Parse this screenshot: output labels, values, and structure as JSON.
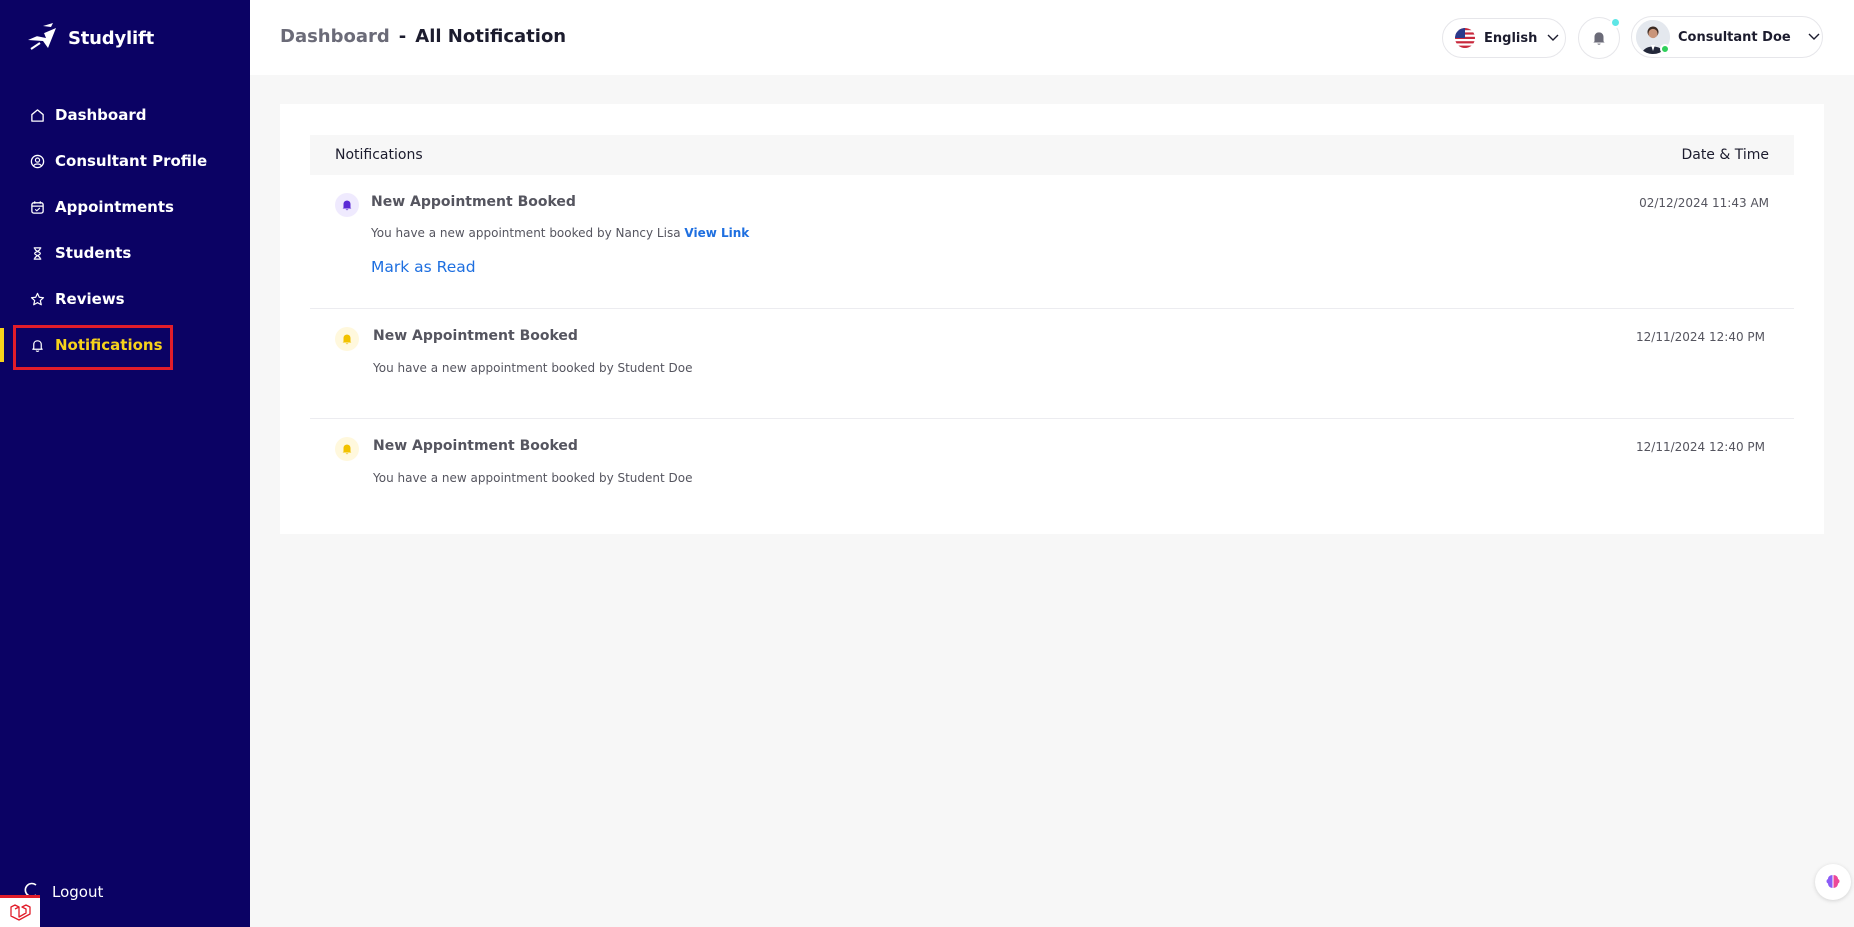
{
  "app": {
    "brand": "Studylift"
  },
  "sidebar": {
    "items": [
      {
        "label": "Dashboard",
        "icon": "home-icon"
      },
      {
        "label": "Consultant Profile",
        "icon": "user-circle-icon"
      },
      {
        "label": "Appointments",
        "icon": "calendar-icon"
      },
      {
        "label": "Students",
        "icon": "hourglass-icon"
      },
      {
        "label": "Reviews",
        "icon": "star-icon"
      },
      {
        "label": "Notifications",
        "icon": "bell-icon",
        "active": true
      }
    ],
    "logout_label": "Logout"
  },
  "header": {
    "crumb_home": "Dashboard",
    "crumb_sep": "-",
    "crumb_current": "All Notification",
    "language": "English",
    "user_name": "Consultant Doe"
  },
  "table": {
    "col_notifications": "Notifications",
    "col_datetime": "Date & Time"
  },
  "notifications": [
    {
      "title": "New Appointment Booked",
      "body": "You have a new appointment booked by Nancy Lisa",
      "link": "View Link",
      "time": "02/12/2024 11:43 AM",
      "action": "Mark as Read",
      "unread": true
    },
    {
      "title": "New Appointment Booked",
      "body": "You have a new appointment booked by Student Doe",
      "time": "12/11/2024 12:40 PM",
      "unread": false
    },
    {
      "title": "New Appointment Booked",
      "body": "You have a new appointment booked by Student Doe",
      "time": "12/11/2024 12:40 PM",
      "unread": false
    }
  ],
  "colors": {
    "sidebar_bg": "#0b0264",
    "accent_yellow": "#f7d21b",
    "link_blue": "#1e6fe0",
    "highlight_red": "#e11d2a",
    "unread_purple": "#5b2bd6"
  }
}
